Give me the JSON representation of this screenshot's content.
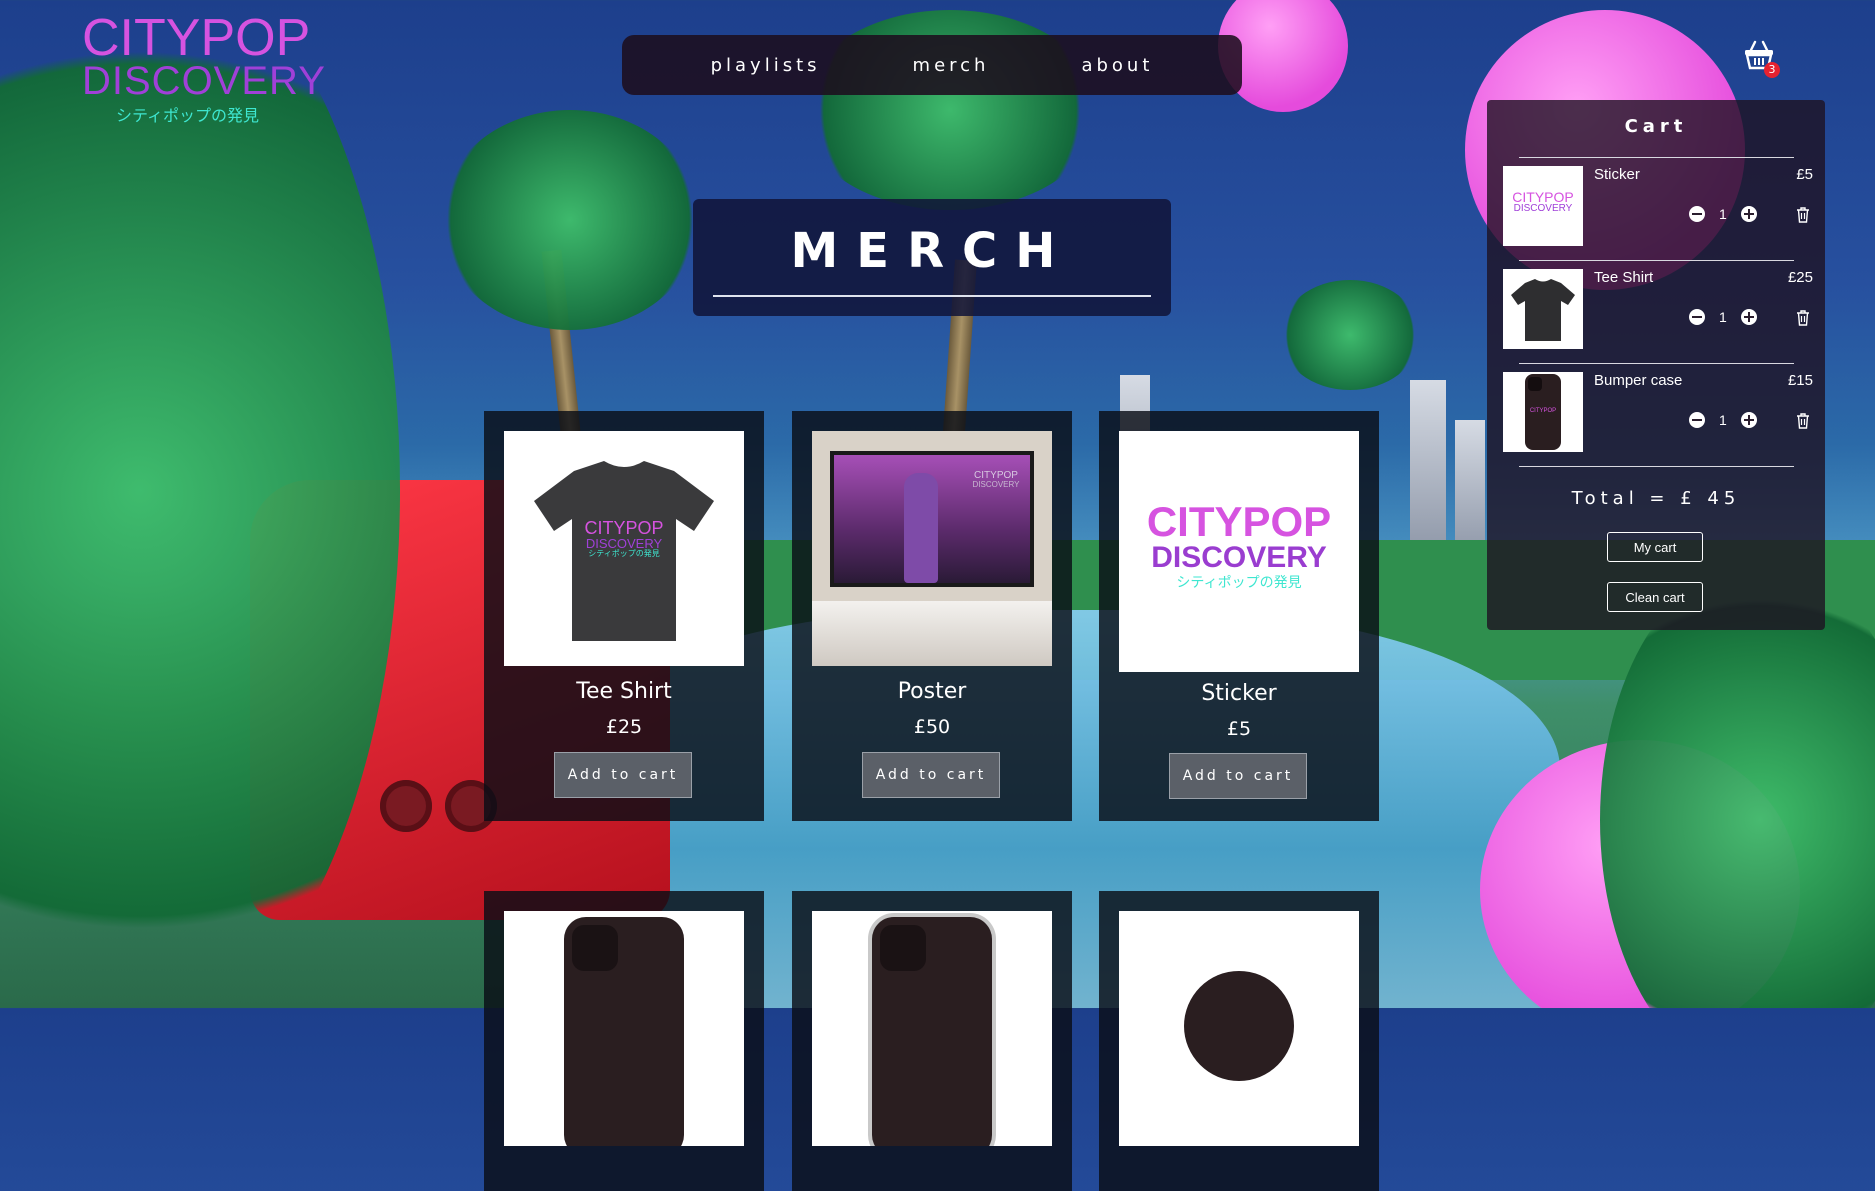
{
  "logo": {
    "line1": "CITYPOP",
    "line2": "DISCOVERY",
    "line3": "シティポップの発見"
  },
  "nav": {
    "items": [
      "playlists",
      "merch",
      "about"
    ]
  },
  "cart_icon": {
    "count": "3"
  },
  "page": {
    "title": "MERCH"
  },
  "products": [
    {
      "name": "Tee Shirt",
      "price": "£25",
      "button": "Add to cart"
    },
    {
      "name": "Poster",
      "price": "£50",
      "button": "Add to cart"
    },
    {
      "name": "Sticker",
      "price": "£5",
      "button": "Add to cart"
    }
  ],
  "product_art": {
    "tee_l1": "CITYPOP",
    "tee_l2": "DISCOVERY",
    "tee_l3": "シティポップの発見",
    "poster_l1": "CITYPOP",
    "poster_l2": "DISCOVERY",
    "sticker_l1": "CITYPOP",
    "sticker_l2": "DISCOVERY",
    "sticker_l3": "シティポップの発見",
    "case_label": "CITYPOP"
  },
  "cart": {
    "title": "Cart",
    "items": [
      {
        "name": "Sticker",
        "price": "£5",
        "qty": "1"
      },
      {
        "name": "Tee Shirt",
        "price": "£25",
        "qty": "1"
      },
      {
        "name": "Bumper case",
        "price": "£15",
        "qty": "1"
      }
    ],
    "total": "Total = £ 45",
    "my_cart": "My cart",
    "clean_cart": "Clean cart"
  },
  "colors": {
    "accent_pink": "#d653e0",
    "accent_purple": "#a040d8",
    "accent_teal": "#3ee6d0",
    "badge_red": "#e6222f"
  }
}
